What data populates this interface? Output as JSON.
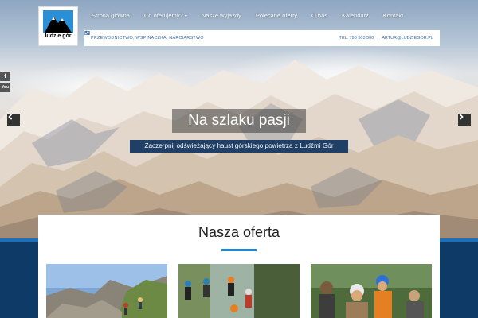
{
  "logo": {
    "text": "ludzie gór"
  },
  "nav": {
    "items": [
      {
        "label": "Strona główna"
      },
      {
        "label": "Co oferujemy?",
        "dropdown": true
      },
      {
        "label": "Nasze wyjazdy"
      },
      {
        "label": "Polecane oferty"
      },
      {
        "label": "O nas"
      },
      {
        "label": "Kalendarz"
      },
      {
        "label": "Kontakt"
      }
    ],
    "caret": "▾"
  },
  "infobar": {
    "tagline": "PRZEWODNICTWO, WSPINACZKA, NARCIARSTWO",
    "phone": "TEL. 790 303 300",
    "email": "ARTUR@LUDZIEGOR.PL"
  },
  "social": {
    "facebook": "f",
    "youtube": "You"
  },
  "slider": {
    "title": "Na szlaku pasji",
    "subtitle": "Zaczerpnij odświeżający haust górskiego powietrza z Ludźmi Gór"
  },
  "offer": {
    "heading": "Nasza oferta"
  },
  "colors": {
    "accent": "#1c88d4",
    "dark_blue": "#0d3a66",
    "subtitle_bg": "#1f3f66"
  },
  "icons": {
    "phone": "phone-icon",
    "email": "email-icon",
    "prev": "chevron-left-icon",
    "next": "chevron-right-icon"
  }
}
